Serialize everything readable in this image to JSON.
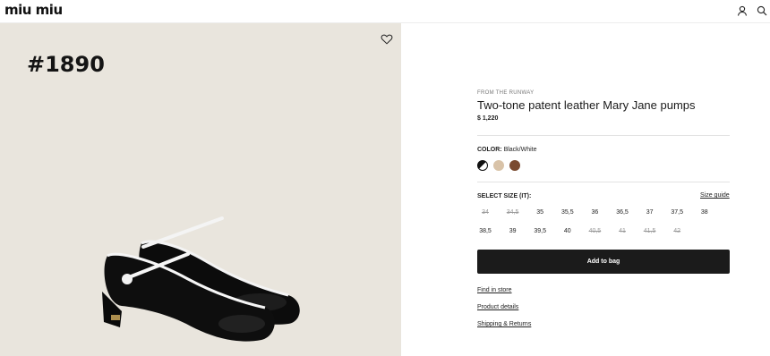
{
  "header": {
    "logo": "miu miu"
  },
  "image": {
    "lot_number": "#1890"
  },
  "product": {
    "eyebrow": "FROM THE RUNWAY",
    "title": "Two-tone patent leather Mary Jane pumps",
    "price": "$ 1,220",
    "color_label": "COLOR:",
    "color_value": "Black/White",
    "swatches": [
      {
        "name": "black-white",
        "color": "#111111",
        "selected": true
      },
      {
        "name": "beige",
        "color": "#d9c3a8",
        "selected": false
      },
      {
        "name": "brown",
        "color": "#7a4a30",
        "selected": false
      }
    ],
    "size_label": "SELECT SIZE (IT):",
    "size_guide": "Size guide",
    "sizes_row1": [
      {
        "label": "34",
        "available": false
      },
      {
        "label": "34,5",
        "available": false
      },
      {
        "label": "35",
        "available": true
      },
      {
        "label": "35,5",
        "available": true
      },
      {
        "label": "36",
        "available": true
      },
      {
        "label": "36,5",
        "available": true
      },
      {
        "label": "37",
        "available": true
      },
      {
        "label": "37,5",
        "available": true
      },
      {
        "label": "38",
        "available": true
      }
    ],
    "sizes_row2": [
      {
        "label": "38,5",
        "available": true
      },
      {
        "label": "39",
        "available": true
      },
      {
        "label": "39,5",
        "available": true
      },
      {
        "label": "40",
        "available": true
      },
      {
        "label": "40,5",
        "available": false
      },
      {
        "label": "41",
        "available": false
      },
      {
        "label": "41,5",
        "available": false
      },
      {
        "label": "42",
        "available": false
      }
    ],
    "add_to_bag": "Add to bag",
    "links": {
      "find_in_store": "Find in store",
      "product_details": "Product details",
      "shipping_returns": "Shipping & Returns"
    }
  }
}
